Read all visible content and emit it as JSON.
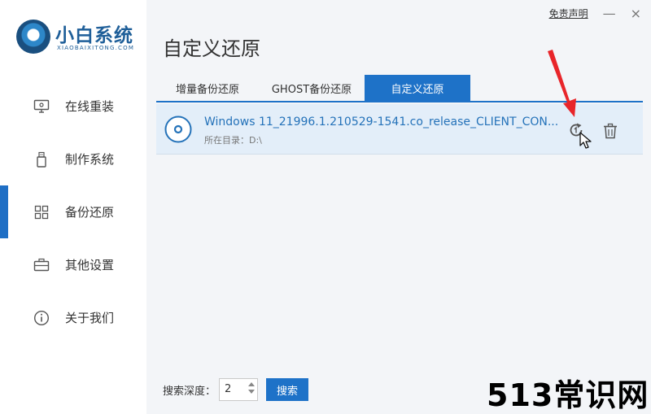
{
  "logo": {
    "title": "小白系统",
    "subtitle": "XIAOBAIXITONG.COM"
  },
  "sidebar": {
    "items": [
      {
        "label": "在线重装",
        "icon": "monitor-icon"
      },
      {
        "label": "制作系统",
        "icon": "usb-icon"
      },
      {
        "label": "备份还原",
        "icon": "grid-icon",
        "active": true
      },
      {
        "label": "其他设置",
        "icon": "briefcase-icon"
      },
      {
        "label": "关于我们",
        "icon": "info-icon"
      }
    ]
  },
  "header": {
    "disclaimer": "免责声明",
    "minimize": "—",
    "close": "×"
  },
  "page": {
    "title": "自定义还原"
  },
  "tabs": [
    {
      "label": "增量备份还原"
    },
    {
      "label": "GHOST备份还原"
    },
    {
      "label": "自定义还原",
      "active": true
    }
  ],
  "backup_list": [
    {
      "name": "Windows 11_21996.1.210529-1541.co_release_CLIENT_CON...",
      "directory": "所在目录：D:\\"
    }
  ],
  "search": {
    "depth_label": "搜索深度：",
    "depth_value": "2",
    "button_label": "搜索"
  },
  "watermark": "513常识网",
  "colors": {
    "accent": "#1e72c8",
    "row_bg": "#e3eef9",
    "annotation_arrow": "#e8252a",
    "main_bg": "#f3f5f8"
  }
}
